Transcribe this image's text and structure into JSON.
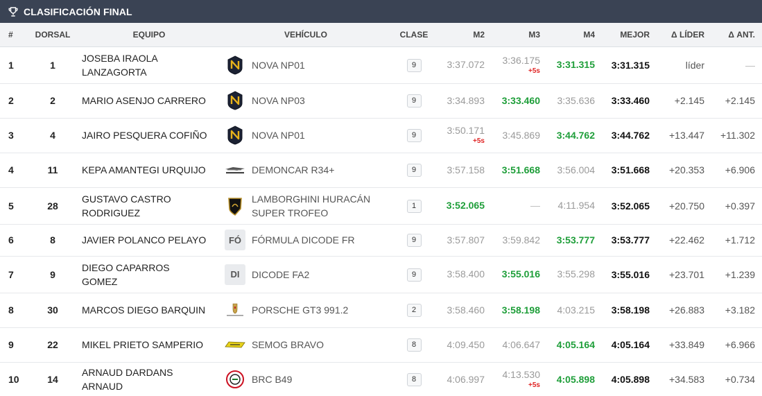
{
  "title": "CLASIFICACIÓN FINAL",
  "colors": {
    "header_bg": "#3a4354",
    "best": "#1e9e39",
    "penalty": "#e02424"
  },
  "columns": {
    "pos": "#",
    "dorsal": "DORSAL",
    "equipo": "EQUIPO",
    "vehiculo": "VEHÍCULO",
    "clase": "CLASE",
    "m2": "M2",
    "m3": "M3",
    "m4": "M4",
    "mejor": "MEJOR",
    "d_lider": "Δ LÍDER",
    "d_ant": "Δ ANT."
  },
  "rows": [
    {
      "pos": "1",
      "dorsal": "1",
      "driver": [
        "JOSEBA IRAOLA",
        "LANZAGORTA"
      ],
      "vehicle": [
        "NOVA NP01"
      ],
      "logo": "nova-logo-icon",
      "clase": "9",
      "m2": "3:37.072",
      "m3": "3:36.175",
      "m3_pen": "+5s",
      "m4": "3:31.315",
      "best_col": "m4",
      "mejor": "3:31.315",
      "d_lider": "líder",
      "d_ant": "—"
    },
    {
      "pos": "2",
      "dorsal": "2",
      "driver": [
        "MARIO ASENJO CARRERO"
      ],
      "vehicle": [
        "NOVA NP03"
      ],
      "logo": "nova-logo-icon",
      "clase": "9",
      "m2": "3:34.893",
      "m3": "3:33.460",
      "m4": "3:35.636",
      "best_col": "m3",
      "mejor": "3:33.460",
      "d_lider": "+2.145",
      "d_ant": "+2.145"
    },
    {
      "pos": "3",
      "dorsal": "4",
      "driver": [
        "JAIRO PESQUERA COFIÑO"
      ],
      "vehicle": [
        "NOVA NP01"
      ],
      "logo": "nova-logo-icon",
      "clase": "9",
      "m2": "3:50.171",
      "m2_pen": "+5s",
      "m3": "3:45.869",
      "m4": "3:44.762",
      "best_col": "m4",
      "mejor": "3:44.762",
      "d_lider": "+13.447",
      "d_ant": "+11.302"
    },
    {
      "pos": "4",
      "dorsal": "11",
      "driver": [
        "KEPA AMANTEGI URQUIJO"
      ],
      "vehicle": [
        "DEMONCAR R34+"
      ],
      "logo": "demoncar-logo-icon",
      "clase": "9",
      "m2": "3:57.158",
      "m3": "3:51.668",
      "m4": "3:56.004",
      "best_col": "m3",
      "mejor": "3:51.668",
      "d_lider": "+20.353",
      "d_ant": "+6.906"
    },
    {
      "pos": "5",
      "dorsal": "28",
      "driver": [
        "GUSTAVO CASTRO",
        "RODRIGUEZ"
      ],
      "vehicle": [
        "LAMBORGHINI HURACÁN",
        "SUPER TROFEO"
      ],
      "logo": "lamborghini-logo-icon",
      "clase": "1",
      "m2": "3:52.065",
      "m3": "—",
      "m4": "4:11.954",
      "best_col": "m2",
      "mejor": "3:52.065",
      "d_lider": "+20.750",
      "d_ant": "+0.397"
    },
    {
      "pos": "6",
      "dorsal": "8",
      "driver": [
        "JAVIER POLANCO PELAYO"
      ],
      "vehicle": [
        "FÓRMULA DICODE FR"
      ],
      "logo": "abbr",
      "abbr": "FÓ",
      "clase": "9",
      "m2": "3:57.807",
      "m3": "3:59.842",
      "m4": "3:53.777",
      "best_col": "m4",
      "mejor": "3:53.777",
      "d_lider": "+22.462",
      "d_ant": "+1.712"
    },
    {
      "pos": "7",
      "dorsal": "9",
      "driver": [
        "DIEGO CAPARROS",
        "GOMEZ"
      ],
      "vehicle": [
        "DICODE FA2"
      ],
      "logo": "abbr",
      "abbr": "DI",
      "clase": "9",
      "m2": "3:58.400",
      "m3": "3:55.016",
      "m4": "3:55.298",
      "best_col": "m3",
      "mejor": "3:55.016",
      "d_lider": "+23.701",
      "d_ant": "+1.239"
    },
    {
      "pos": "8",
      "dorsal": "30",
      "driver": [
        "MARCOS DIEGO BARQUIN"
      ],
      "vehicle": [
        "PORSCHE GT3 991.2"
      ],
      "logo": "porsche-logo-icon",
      "clase": "2",
      "m2": "3:58.460",
      "m3": "3:58.198",
      "m4": "4:03.215",
      "best_col": "m3",
      "mejor": "3:58.198",
      "d_lider": "+26.883",
      "d_ant": "+3.182"
    },
    {
      "pos": "9",
      "dorsal": "22",
      "driver": [
        "MIKEL PRIETO SAMPERIO"
      ],
      "vehicle": [
        "SEMOG BRAVO"
      ],
      "logo": "semog-logo-icon",
      "clase": "8",
      "m2": "4:09.450",
      "m3": "4:06.647",
      "m4": "4:05.164",
      "best_col": "m4",
      "mejor": "4:05.164",
      "d_lider": "+33.849",
      "d_ant": "+6.966"
    },
    {
      "pos": "10",
      "dorsal": "14",
      "driver": [
        "ARNAUD DARDANS",
        "ARNAUD"
      ],
      "vehicle": [
        "BRC B49"
      ],
      "logo": "brc-logo-icon",
      "clase": "8",
      "m2": "4:06.997",
      "m3": "4:13.530",
      "m3_pen": "+5s",
      "m4": "4:05.898",
      "best_col": "m4",
      "mejor": "4:05.898",
      "d_lider": "+34.583",
      "d_ant": "+0.734"
    }
  ]
}
